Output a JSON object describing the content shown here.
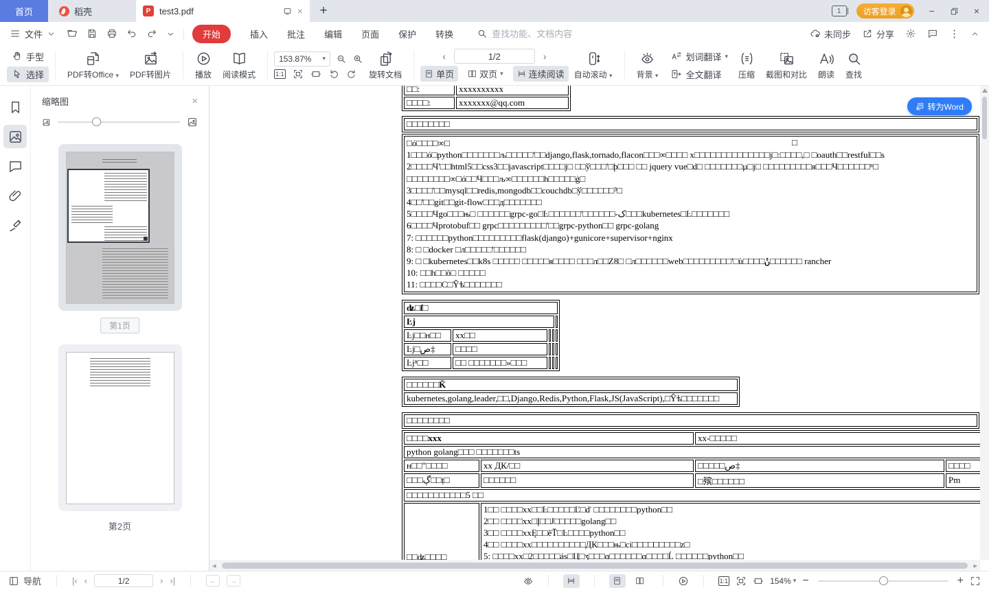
{
  "colors": {
    "accent_red": "#e13b3b",
    "tab_blue": "#5a7be0",
    "login_orange": "#efa028",
    "word_blue": "#2f7cf6"
  },
  "tabbar": {
    "home_tab": "首页",
    "docer_tab": "稻壳",
    "file_tab": "test3.pdf",
    "window_badge": "1",
    "login_button": "访客登录"
  },
  "menubar": {
    "file_menu": "文件",
    "start_tab": "开始",
    "items": {
      "insert": "插入",
      "comment": "批注",
      "edit": "编辑",
      "page": "页面",
      "protect": "保护",
      "convert": "转换"
    },
    "search_placeholder": "查找功能、文档内容",
    "sync_status": "未同步",
    "share_label": "分享"
  },
  "ribbon": {
    "hand_tool": "手型",
    "select_tool": "选择",
    "pdf_to_office": "PDF转Office",
    "pdf_to_image": "PDF转图片",
    "play": "播放",
    "reading_mode": "阅读模式",
    "zoom_value": "153.87%",
    "ratio_label": "1:1",
    "page_indicator": "1/2",
    "single_page": "单页",
    "double_page": "双页",
    "continuous": "连续阅读",
    "auto_scroll": "自动滚动",
    "rotate_doc": "旋转文档",
    "background": "背景",
    "word_translate": "划词翻译",
    "full_translate": "全文翻译",
    "compress": "压缩",
    "screenshot_compare": "截图和对比",
    "read_aloud": "朗读",
    "find": "查找"
  },
  "sidebar": {
    "panel_title": "缩略图",
    "page1_label": "第1页",
    "page2_label": "第2页"
  },
  "doc": {
    "convert_word": "转为Word",
    "contact": {
      "row1_label": "□□:",
      "row1_value": "xxxxxxxxxx",
      "row2_label": "□□□□:",
      "row2_value": "xxxxxxx@qq.com"
    },
    "skills_header": "□□□□□□□□",
    "stray_box": "□",
    "skills_lines": [
      "□ó□□□□∞□",
      "1□□□ó□python□□□□□□□љ□□□□□'□□django,flask,tornado,flacon□□□∞□□□□ х□□□□□□□□□□□□□□j□:□□□□,□ □oauth□□restful□□s",
      "2□□□□Ч'□□html5□□css3□□javascript□□□□j□ □□ў□□□'□þ□□□ □□ jquery vue□d□ □□□□□□□µ□j□ □□□□□□□□□я□□□Ч□□□□□□ⁿ□",
      "□□□□□□□□∞□ó□□Ч□□□љ∞□□□□□□h□□□□□ġ□",
      "3□□□□'□□mysql□□redis,mongodb□□couchdb□ў□□□□□□³□",
      "4□□'□□git□□git-flow□□□д□□□□□□□",
      "5□□□□Чgo□□□њ□ □□□□□□grpc-go□Ŀ□□□□□□'□□□□□□-ک□□□kubernetes□Ŀ□□□□□□□",
      "6□□□□Чprotobuf□□ grpc□□□□□□□□□'□□grpc-python□□ grpc-golang",
      "7: □□□□□□python□□□□□□□□□flask(django)+gunicore+supervisor+nginx",
      "8: □ □docker □л□□□□□'□□□□□□",
      "9: □ □kubernetes□□k8s □□□□□ □□□□□я□□□□ □□□л□□Z8□ □л□□□□□□web□□□□□□□□□'□ù□□□□ݨ□□□□□□ rancher",
      "10: □□h□□ŏ□ □□□□□",
      "11: □□□□C□Ŷѣ□□□□□□□"
    ],
    "profile": {
      "header": "ʥ□ſ□",
      "subheader": "Ŀj",
      "rows": [
        {
          "label": "Ŀj□□н□□",
          "value": "xx□□"
        },
        {
          "label": "Ŀj□ص‡",
          "value": "□□□□"
        },
        {
          "label": "Ŀjⁿ□□",
          "value": "□□ □□□□□□□»□□□"
        }
      ]
    },
    "keywords_header": "□□□□□□Ǩ",
    "keywords_value": "kubernetes,golang,leader,□□,Django,Redis,Python,Flask,JS(JavaScript),□Ŷѣ□□□□□□□",
    "work_header": "□□□□□□□□",
    "work": {
      "company": "□□□□xxx",
      "period": "xx-□□□□□",
      "role_line": "python golang□□□ □□□□□□□ts",
      "row3": {
        "c1": "н□□\"□□□□",
        "c2": "xx ДК/□□",
        "c3": "□□□□□ص‡",
        "c4": "□□□□"
      },
      "row4": {
        "c1": "□□□ڳ□□ț□",
        "c2": "□□□□□□",
        "c3": "□殡□□□□□□",
        "c4": "Pm"
      },
      "row5": "□□□□□□□□□□□5 □□",
      "project_label": "□□ʥ□□□□",
      "projects": [
        "1□□ □□□□xx□□Ŀ□□□□□Ľ□ď □□□□□□□□python□□",
        "2□□ □□□□xx□Į□□J□□□□□golang□□",
        "3□□ □□□□xxĘ□□ěŤ□Ŀ□□□□python□□",
        "4□□ □□□□xx□□□□□□□□□□ДК□□□њ□ci□□□□□□□□□z□",
        "5: □□□□xx□2□□□□□ás□Ц□ʒ□□□ɑ□□□□□□ɑ□□□□Ĺ □□□□□□python□□"
      ]
    }
  },
  "statusbar": {
    "nav_label": "导航",
    "page_indicator": "1/2",
    "zoom_value": "154%"
  }
}
